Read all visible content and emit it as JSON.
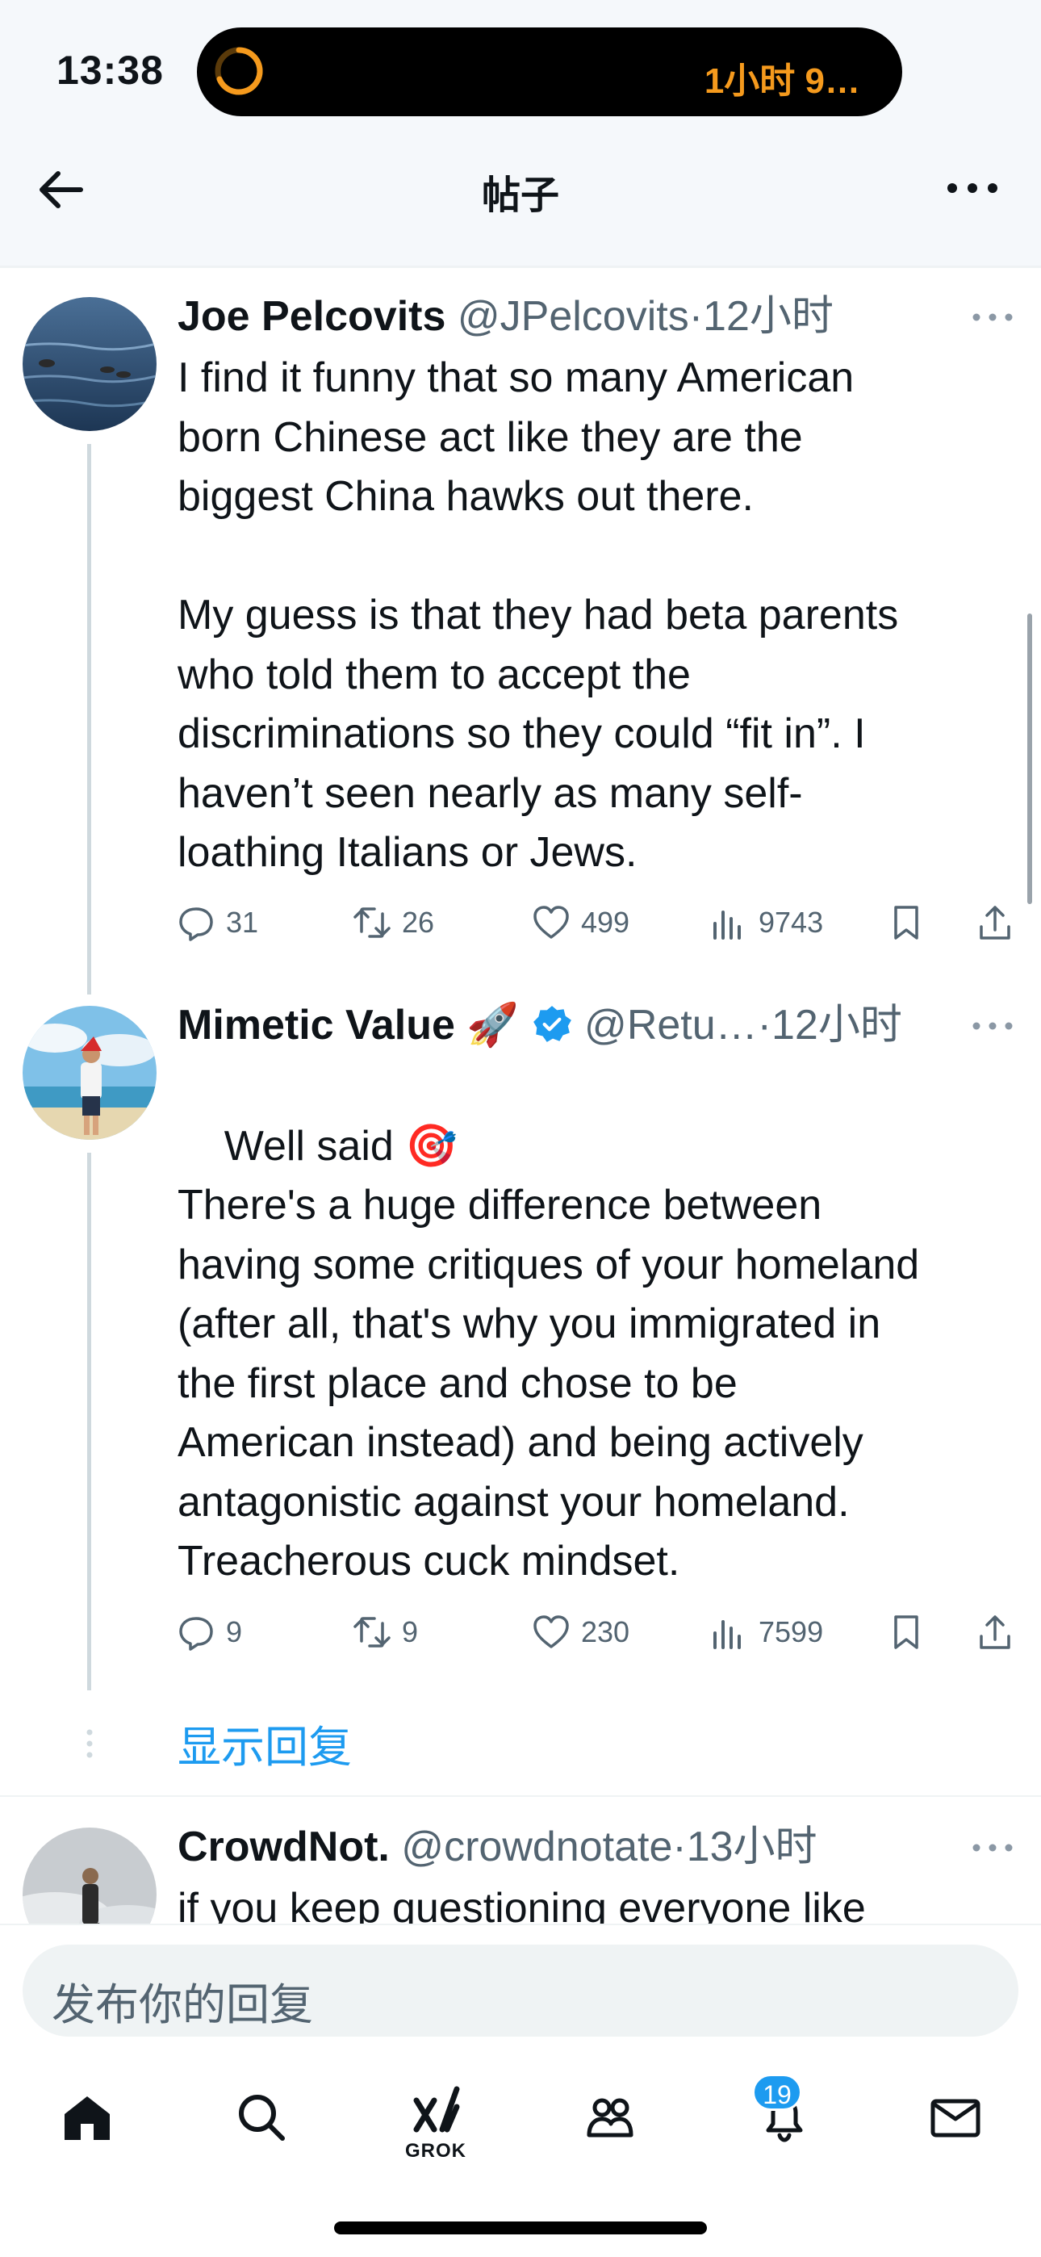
{
  "status_bar": {
    "time": "13:38",
    "island_text": "1小时 9…",
    "island_color": "#f59a1d"
  },
  "nav": {
    "title": "帖子"
  },
  "tweets": [
    {
      "name": "Joe Pelcovits",
      "handle": "@JPelcovits",
      "dot": "·",
      "time": "12小时",
      "badge": "",
      "emoji_after_name": "",
      "body": "I find it funny that so many American\nborn Chinese act like they are the\nbiggest China hawks out there.\n\nMy guess is that they had beta parents\nwho told them to accept the\ndiscriminations so they could “fit in”. I\nhaven’t seen nearly as many self-\nloathing Italians or Jews.",
      "replies": "31",
      "retweets": "26",
      "likes": "499",
      "views": "9743"
    },
    {
      "name": "Mimetic Value",
      "handle": "@Retu…",
      "dot": "·",
      "time": "12小时",
      "badge": "verified",
      "emoji_after_name": "🚀",
      "body_first": "Well said",
      "body_emoji": "🎯",
      "body": "There's a huge difference between\nhaving some critiques of your homeland\n(after all, that's why you immigrated in\nthe first place and chose to be\nAmerican instead) and being actively\nantagonistic against your homeland.\nTreacherous cuck mindset.",
      "replies": "9",
      "retweets": "9",
      "likes": "230",
      "views": "7599"
    },
    {
      "name": "CrowdNot.",
      "handle": "@crowdnotate",
      "dot": "·",
      "time": "13小时",
      "body": "if you keep questioning everyone like"
    }
  ],
  "show_replies": "显示回复",
  "composer": {
    "placeholder": "发布你的回复"
  },
  "tabbar": {
    "grok_label": "GROK",
    "notifications_badge": "19"
  },
  "colors": {
    "accent": "#1d9bf0",
    "secondary_text": "#536471",
    "text": "#0f1419"
  }
}
